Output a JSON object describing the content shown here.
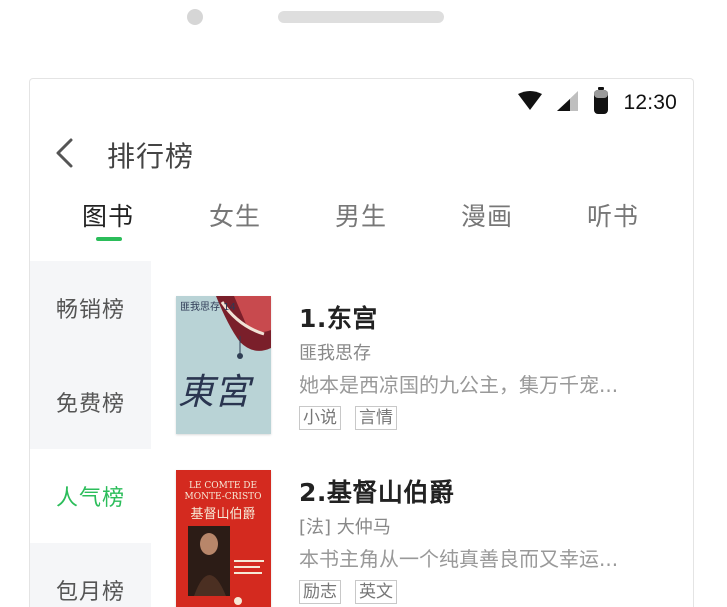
{
  "status_bar": {
    "time": "12:30",
    "icons": [
      "wifi-icon",
      "cellular-signal-icon",
      "battery-icon"
    ]
  },
  "header": {
    "back_icon": "chevron-left-icon",
    "title": "排行榜"
  },
  "tabs": [
    {
      "label": "图书",
      "active": true
    },
    {
      "label": "女生",
      "active": false
    },
    {
      "label": "男生",
      "active": false
    },
    {
      "label": "漫画",
      "active": false
    },
    {
      "label": "听书",
      "active": false
    }
  ],
  "sidebar": {
    "items": [
      {
        "label": "畅销榜",
        "active": false
      },
      {
        "label": "免费榜",
        "active": false
      },
      {
        "label": "人气榜",
        "active": true
      },
      {
        "label": "包月榜",
        "active": false
      }
    ]
  },
  "books": [
    {
      "title": "1.东宫",
      "author": "匪我思存",
      "description": "她本是西凉国的九公主，集万千宠...",
      "tags": [
        "小说",
        "言情"
      ],
      "cover": {
        "text": "東宮",
        "top_text": "匪我思存 14",
        "background": "#b9d3d6"
      }
    },
    {
      "title": "2.基督山伯爵",
      "author": "[法] 大仲马",
      "description": "本书主角从一个纯真善良而又幸运...",
      "tags": [
        "励志",
        "英文"
      ],
      "cover": {
        "text": "基督山伯爵",
        "top_text": "LE COMTE DE MONTE-CRISTO",
        "background": "#d42a1f"
      }
    }
  ],
  "colors": {
    "accent": "#2bbd5a",
    "sidebar_bg": "#f5f6f8"
  }
}
